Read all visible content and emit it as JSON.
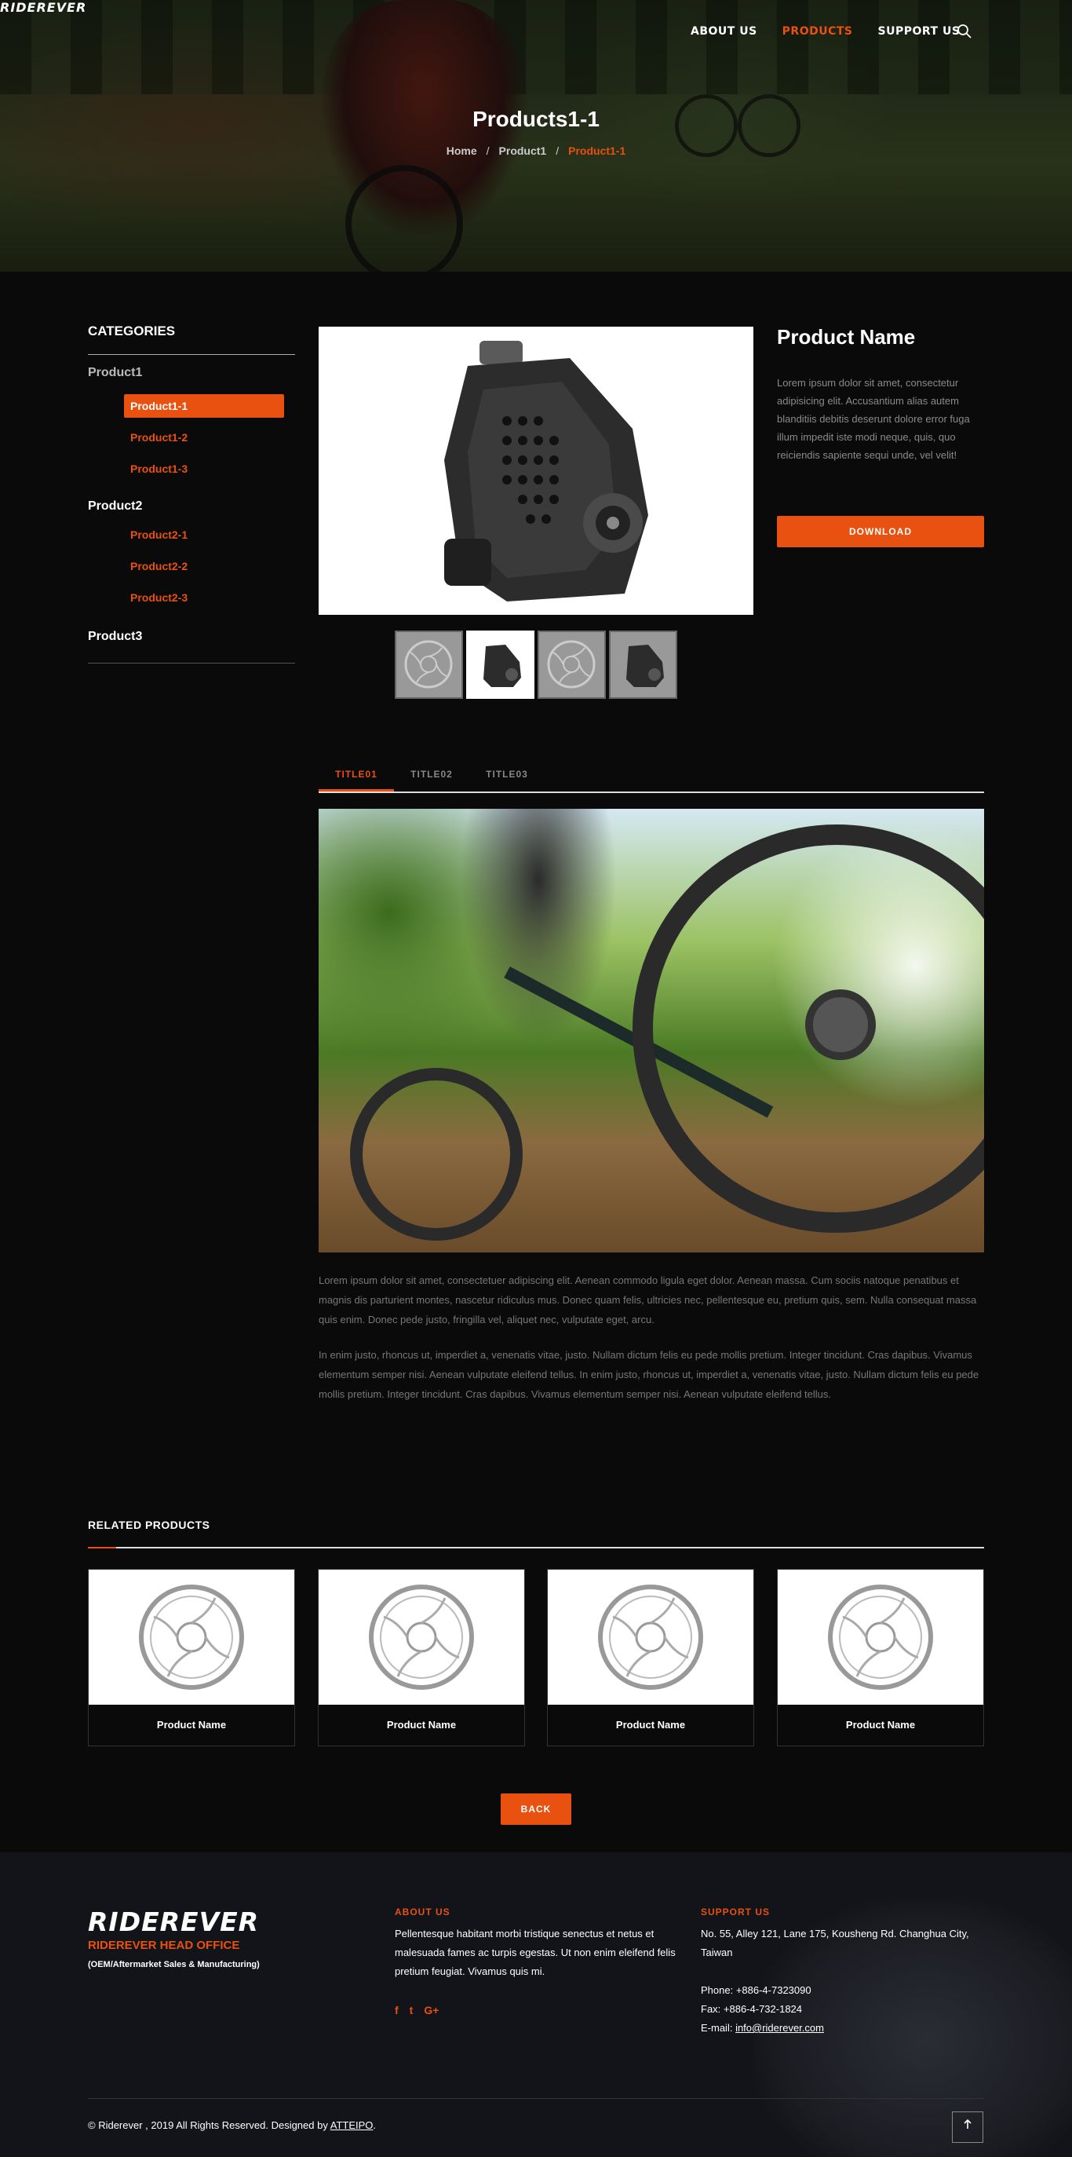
{
  "brand": {
    "logo_main": "RIDEREVER",
    "accent_color": "#e8510f"
  },
  "nav": {
    "items": [
      "ABOUT US",
      "PRODUCTS",
      "SUPPORT US"
    ],
    "active_index": 1
  },
  "hero": {
    "title": "Products1-1",
    "breadcrumb": [
      "Home",
      "Product1",
      "Product1-1"
    ]
  },
  "sidebar": {
    "title": "CATEGORIES",
    "groups": [
      {
        "label": "Product1",
        "items": [
          "Product1-1",
          "Product1-2",
          "Product1-3"
        ],
        "active_item": 0
      },
      {
        "label": "Product2",
        "items": [
          "Product2-1",
          "Product2-2",
          "Product2-3"
        ]
      },
      {
        "label": "Product3",
        "items": []
      }
    ]
  },
  "product": {
    "name": "Product Name",
    "description": "Lorem ipsum dolor sit amet, consectetur adipisicing elit. Accusantium alias autem blanditiis debitis deserunt dolore error fuga illum impedit iste modi neque, quis, quo reiciendis sapiente sequi unde, vel velit!",
    "download_label": "DOWNLOAD",
    "thumbnails": [
      "disc-rotor-icon",
      "brake-caliper-icon",
      "disc-rotor-icon",
      "brake-caliper-icon"
    ],
    "active_thumbnail": 1
  },
  "tabs": {
    "items": [
      "TITLE01",
      "TITLE02",
      "TITLE03"
    ],
    "active_index": 0
  },
  "content": {
    "paragraph1": "Lorem ipsum dolor sit amet, consectetuer adipiscing elit. Aenean commodo ligula eget dolor. Aenean massa. Cum sociis natoque penatibus et magnis dis parturient montes, nascetur ridiculus mus. Donec quam felis, ultricies nec, pellentesque eu, pretium quis, sem. Nulla consequat massa quis enim. Donec pede justo, fringilla vel, aliquet nec, vulputate eget, arcu.",
    "paragraph2": "In enim justo, rhoncus ut, imperdiet a, venenatis vitae, justo. Nullam dictum felis eu pede mollis pretium. Integer tincidunt. Cras dapibus. Vivamus elementum semper nisi. Aenean vulputate eleifend tellus. In enim justo, rhoncus ut, imperdiet a, venenatis vitae, justo. Nullam dictum felis eu pede mollis pretium. Integer tincidunt. Cras dapibus. Vivamus elementum semper nisi. Aenean vulputate eleifend tellus."
  },
  "related": {
    "title": "RELATED PRODUCTS",
    "items": [
      {
        "name": "Product Name"
      },
      {
        "name": "Product Name"
      },
      {
        "name": "Product Name"
      },
      {
        "name": "Product Name"
      }
    ]
  },
  "back_label": "BACK",
  "footer": {
    "office_title": "RIDEREVER HEAD OFFICE",
    "office_subtitle": "(OEM/Aftermarket Sales & Manufacturing)",
    "about": {
      "heading": "ABOUT US",
      "text": "Pellentesque habitant morbi tristique senectus et netus et malesuada fames ac turpis egestas. Ut non enim eleifend felis pretium feugiat. Vivamus quis mi.",
      "social": [
        "f",
        "t",
        "G+"
      ]
    },
    "support": {
      "heading": "SUPPORT US",
      "address": "No. 55, Alley 121, Lane 175, Kousheng Rd. Changhua City, Taiwan",
      "phone": "Phone: +886-4-7323090",
      "fax": "Fax: +886-4-732-1824",
      "email_label": "E-mail: ",
      "email": "info@riderever.com"
    },
    "copyright_prefix": "© Riderever , 2019 All Rights Reserved. Designed by ",
    "designer": "ATTEIPO",
    "copyright_suffix": ".",
    "to_top_icon": "arrow-up-icon"
  }
}
